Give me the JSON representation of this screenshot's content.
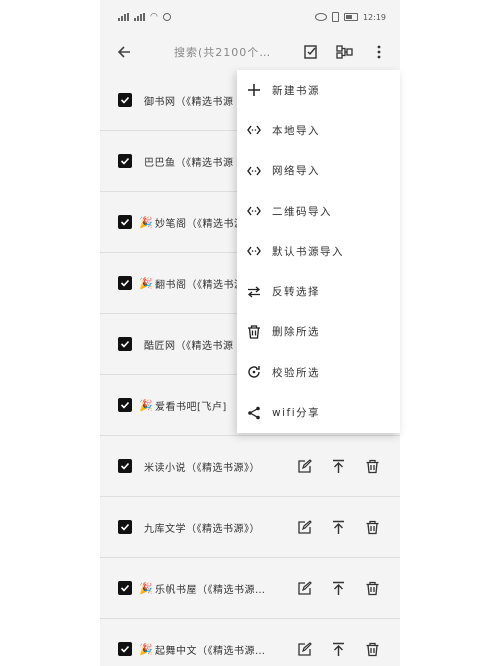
{
  "status_bar": {
    "time": "12:19"
  },
  "toolbar": {
    "search_placeholder": "搜索(共2100个…"
  },
  "rows": [
    {
      "label": "御书网（《精选书源",
      "emoji": "",
      "checked": true
    },
    {
      "label": "巴巴鱼（《精选书源",
      "emoji": "",
      "checked": true
    },
    {
      "label": "妙笔阁（《精选书源",
      "emoji": "🎉",
      "checked": true
    },
    {
      "label": "翻书阁（《精选书源",
      "emoji": "🎉",
      "checked": true
    },
    {
      "label": "酷匠网（《精选书源",
      "emoji": "",
      "checked": true
    },
    {
      "label": "爱看书吧[飞卢]",
      "emoji": "🎉",
      "checked": true
    },
    {
      "label": "米读小说（《精选书源》）",
      "emoji": "",
      "checked": true
    },
    {
      "label": "九库文学（《精选书源》）",
      "emoji": "",
      "checked": true
    },
    {
      "label": "乐帆书屋（《精选书源…",
      "emoji": "🎉",
      "checked": true
    },
    {
      "label": "起舞中文（《精选书源…",
      "emoji": "🎉",
      "checked": true
    }
  ],
  "menu": {
    "items": [
      {
        "label": "新建书源",
        "icon": "plus-icon"
      },
      {
        "label": "本地导入",
        "icon": "code-diamond-icon"
      },
      {
        "label": "网络导入",
        "icon": "code-diamond-icon"
      },
      {
        "label": "二维码导入",
        "icon": "code-diamond-icon"
      },
      {
        "label": "默认书源导入",
        "icon": "code-diamond-icon"
      },
      {
        "label": "反转选择",
        "icon": "swap-arrows-icon"
      },
      {
        "label": "删除所选",
        "icon": "trash-icon"
      },
      {
        "label": "校验所选",
        "icon": "refresh-check-icon"
      },
      {
        "label": "wifi分享",
        "icon": "share-icon"
      }
    ]
  }
}
